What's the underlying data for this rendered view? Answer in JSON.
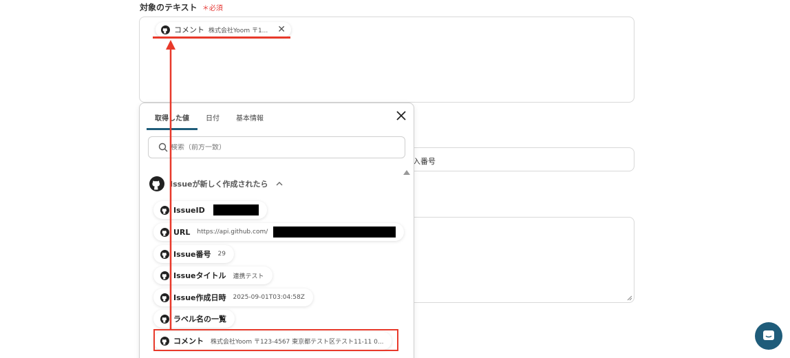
{
  "field": {
    "label": "対象のテキスト",
    "required": "＊必須"
  },
  "selected_chip": {
    "label": "コメント",
    "value": "株式会社Yoom 〒1...",
    "icon": "github-icon"
  },
  "background": {
    "input_text": "入番号"
  },
  "panel": {
    "tabs": [
      "取得した値",
      "日付",
      "基本情報"
    ],
    "search_placeholder": "検索（前方一致）",
    "group_title": "Issueが新しく作成されたら",
    "items": [
      {
        "label": "IssueID",
        "value": ""
      },
      {
        "label": "URL",
        "value": "https://api.github.com/"
      },
      {
        "label": "Issue番号",
        "value": "29"
      },
      {
        "label": "Issueタイトル",
        "value": "連携テスト"
      },
      {
        "label": "Issue作成日時",
        "value": "2025-09-01T03:04:58Z"
      },
      {
        "label": "ラベル名の一覧",
        "value": ""
      },
      {
        "label": "コメント",
        "value": "株式会社Yoom 〒123-4567 東京都テスト区テスト11-11 0..."
      }
    ]
  },
  "colors": {
    "accent": "#1f5c7a",
    "annotation": "#e8392a",
    "required": "#e53935"
  }
}
